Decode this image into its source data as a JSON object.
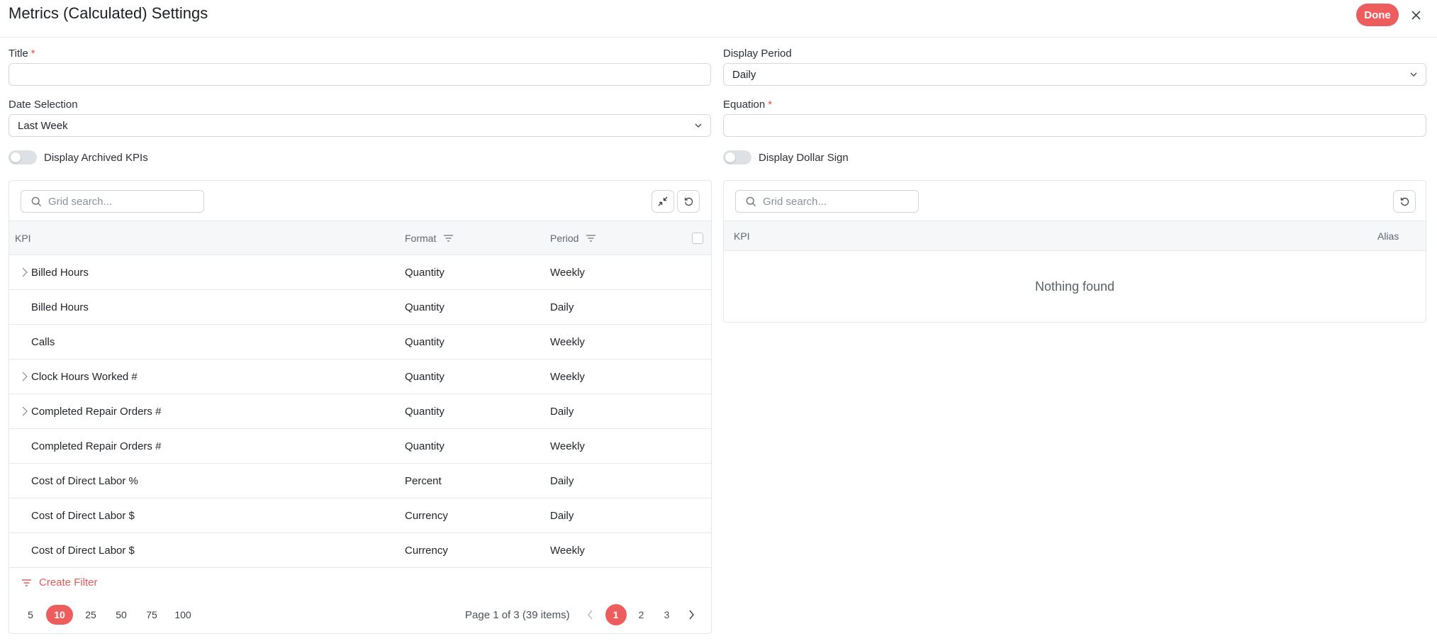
{
  "header": {
    "title": "Metrics (Calculated) Settings",
    "done_label": "Done"
  },
  "form": {
    "title_label": "Title",
    "title_value": "",
    "display_period_label": "Display Period",
    "display_period_value": "Daily",
    "date_selection_label": "Date Selection",
    "date_selection_value": "Last Week",
    "equation_label": "Equation",
    "equation_value": "",
    "required_mark": "*",
    "archived_toggle_label": "Display Archived KPIs",
    "archived_toggle_on": false,
    "dollar_toggle_label": "Display Dollar Sign",
    "dollar_toggle_on": false
  },
  "left_grid": {
    "search_placeholder": "Grid search...",
    "columns": {
      "kpi": "KPI",
      "format": "Format",
      "period": "Period"
    },
    "rows": [
      {
        "kpi": "Billed Hours",
        "format": "Quantity",
        "period": "Weekly",
        "expandable": true
      },
      {
        "kpi": "Billed Hours",
        "format": "Quantity",
        "period": "Daily",
        "expandable": false
      },
      {
        "kpi": "Calls",
        "format": "Quantity",
        "period": "Weekly",
        "expandable": false
      },
      {
        "kpi": "Clock Hours Worked #",
        "format": "Quantity",
        "period": "Weekly",
        "expandable": true
      },
      {
        "kpi": "Completed Repair Orders #",
        "format": "Quantity",
        "period": "Daily",
        "expandable": true
      },
      {
        "kpi": "Completed Repair Orders #",
        "format": "Quantity",
        "period": "Weekly",
        "expandable": false
      },
      {
        "kpi": "Cost of Direct Labor %",
        "format": "Percent",
        "period": "Daily",
        "expandable": false
      },
      {
        "kpi": "Cost of Direct Labor $",
        "format": "Currency",
        "period": "Daily",
        "expandable": false
      },
      {
        "kpi": "Cost of Direct Labor $",
        "format": "Currency",
        "period": "Weekly",
        "expandable": false
      }
    ],
    "create_filter_label": "Create Filter",
    "page_sizes": [
      "5",
      "10",
      "25",
      "50",
      "75",
      "100"
    ],
    "active_page_size": "10",
    "page_info": "Page 1 of 3 (39 items)",
    "pages": [
      "1",
      "2",
      "3"
    ],
    "active_page": "1"
  },
  "right_grid": {
    "search_placeholder": "Grid search...",
    "columns": {
      "kpi": "KPI",
      "alias": "Alias"
    },
    "empty_text": "Nothing found"
  },
  "colors": {
    "accent": "#ee5d5d",
    "required": "#e34a4a",
    "header_bg": "#f6f7f8",
    "border": "#e3e6ea"
  },
  "icons": [
    "close-icon",
    "search-icon",
    "collapse-icon",
    "reset-icon",
    "filter-icon",
    "chevron-down-icon",
    "chevron-right-icon",
    "chevron-left-icon"
  ]
}
